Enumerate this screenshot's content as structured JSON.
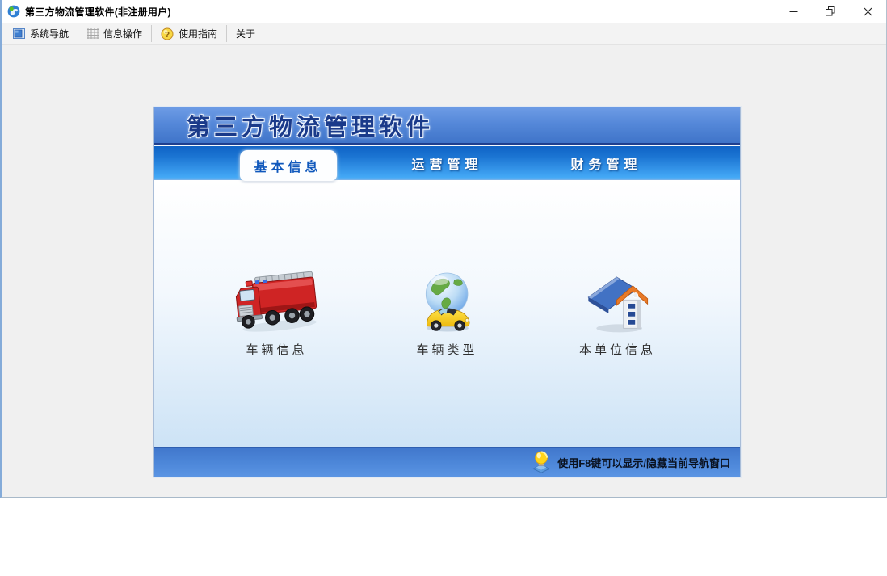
{
  "window": {
    "title": "第三方物流管理软件(非注册用户)",
    "controls": [
      {
        "name": "minimize",
        "icon": "minimize-icon"
      },
      {
        "name": "restore",
        "icon": "restore-icon"
      },
      {
        "name": "close",
        "icon": "close-icon"
      }
    ]
  },
  "toolbar": {
    "items": [
      {
        "label": "系统导航",
        "icon": "navigation-panel-icon"
      },
      {
        "label": "信息操作",
        "icon": "grid-icon"
      },
      {
        "label": "使用指南",
        "icon": "help-icon"
      },
      {
        "label": "关于",
        "icon": null
      }
    ]
  },
  "panel": {
    "banner_title": "第三方物流管理软件",
    "tabs": [
      {
        "label": "基本信息",
        "active": true
      },
      {
        "label": "运营管理",
        "active": false
      },
      {
        "label": "财务管理",
        "active": false
      }
    ],
    "shortcuts": [
      {
        "label": "车辆信息",
        "icon": "fire-truck-icon"
      },
      {
        "label": "车辆类型",
        "icon": "globe-car-icon"
      },
      {
        "label": "本单位信息",
        "icon": "house-icon"
      }
    ],
    "statusbar": {
      "icon": "lightbulb-icon",
      "text": "使用F8键可以显示/隐藏当前导航窗口"
    }
  },
  "colors": {
    "banner_blue_top": "#6d9ce5",
    "banner_blue_bottom": "#3f74c9",
    "tabbar_blue_top": "#0f63c6",
    "tabbar_blue_bottom": "#44a9f6",
    "statusbar_blue": "#4c86d8",
    "active_tab_text": "#1058bc",
    "banner_title_text": "#1a3a8a",
    "window_border_blue": "#84abd9",
    "toolbar_bg": "#f3f3f3",
    "content_fade_blue": "#cde3f6"
  }
}
